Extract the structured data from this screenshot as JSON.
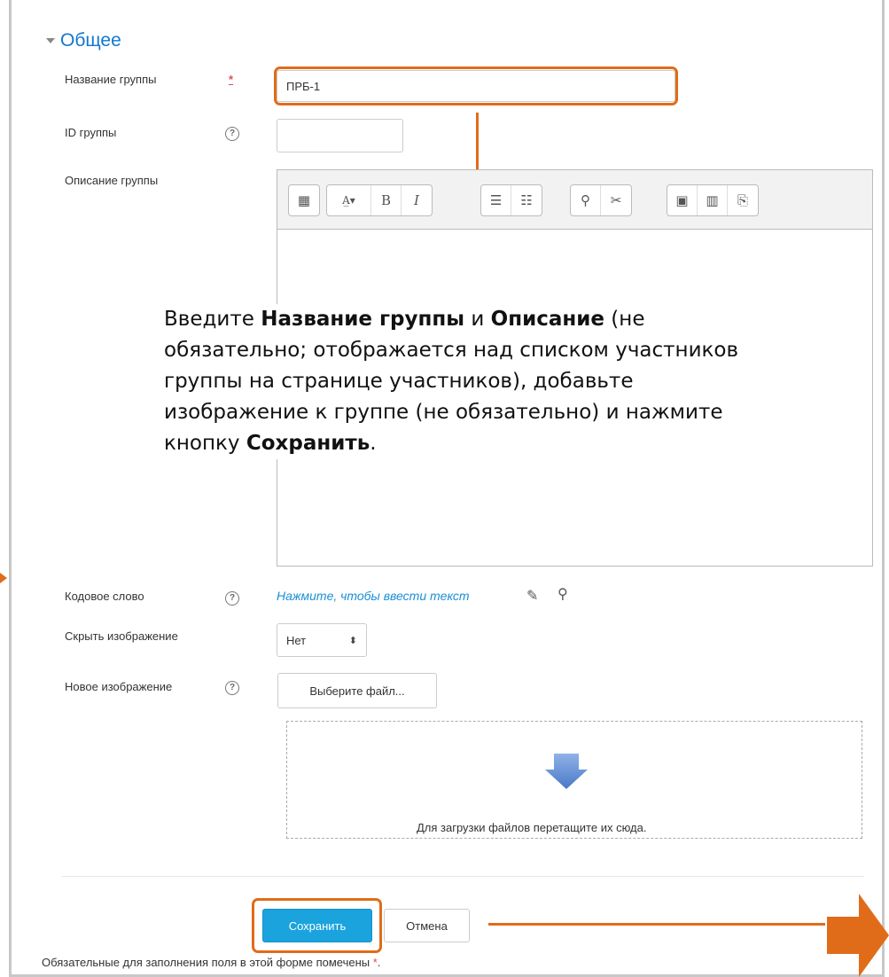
{
  "section": {
    "title": "Общее"
  },
  "fields": {
    "group_name": {
      "label": "Название группы",
      "value": "ПРБ-1",
      "required_mark": "*"
    },
    "group_id": {
      "label": "ID группы",
      "value": ""
    },
    "description": {
      "label": "Описание группы"
    },
    "enrolment_key": {
      "label": "Кодовое слово",
      "link": "Нажмите, чтобы ввести текст"
    },
    "hide_picture": {
      "label": "Скрыть изображение",
      "value": "Нет"
    },
    "new_picture": {
      "label": "Новое изображение",
      "choose_button": "Выберите файл...",
      "drop_text": "Для загрузки файлов перетащите их сюда."
    }
  },
  "help_glyph": "?",
  "callout": {
    "p1": "Введите ",
    "b1": "Название группы",
    "p2": " и ",
    "b2": "Описание",
    "p3": " (не обязательно; отображается над списком участников группы на странице участников), добавьте изображение к группе (не обязательно) и нажмите кнопку ",
    "b3": "Сохранить",
    "p4": "."
  },
  "buttons": {
    "save": "Сохранить",
    "cancel": "Отмена"
  },
  "footer": {
    "text": "Обязательные для заполнения поля в этой форме помечены ",
    "mark": "*",
    "end": "."
  },
  "colors": {
    "accent": "#e06c1a",
    "link": "#1177d1",
    "primary": "#1aa3dd",
    "required": "#d9534f"
  }
}
